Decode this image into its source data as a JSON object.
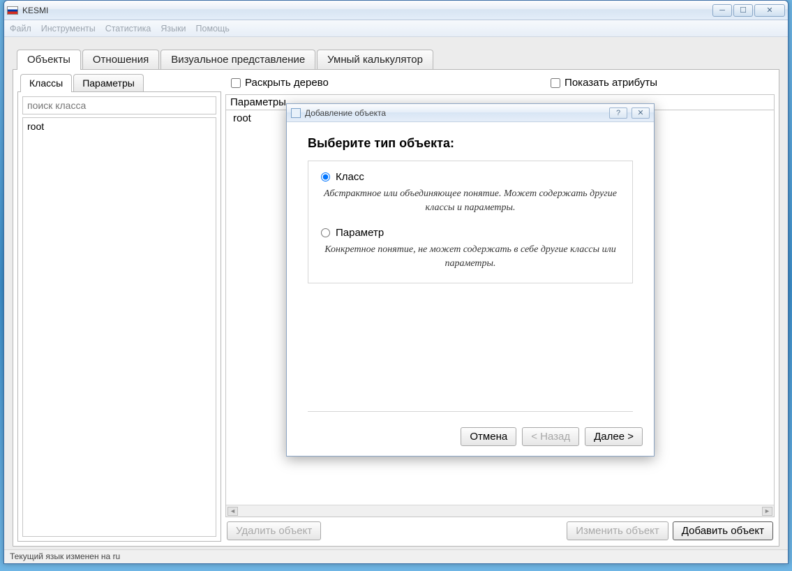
{
  "window": {
    "title": "KESMI"
  },
  "menu": {
    "file": "Файл",
    "tools": "Инструменты",
    "stats": "Статистика",
    "langs": "Языки",
    "help": "Помощь"
  },
  "tabs": {
    "objects": "Объекты",
    "relations": "Отношения",
    "visual": "Визуальное представление",
    "calc": "Умный калькулятор"
  },
  "subtabs": {
    "classes": "Классы",
    "params": "Параметры"
  },
  "left": {
    "search_placeholder": "поиск класса",
    "tree_root": "root"
  },
  "checks": {
    "expand": "Раскрыть дерево",
    "show_attrs": "Показать атрибуты"
  },
  "param_panel": {
    "header": "Параметры",
    "row0": "root"
  },
  "buttons": {
    "delete": "Удалить объект",
    "edit": "Изменить объект",
    "add": "Добавить объект"
  },
  "status": "Текущий язык изменен на ru",
  "dialog": {
    "title": "Добавление объекта",
    "heading": "Выберите тип объекта:",
    "opt_class": "Класс",
    "opt_class_desc": "Абстрактное или объединяющее понятие. Может содержать другие классы и параметры.",
    "opt_param": "Параметр",
    "opt_param_desc": "Конкретное понятие, не может содержать в себе другие классы или параметры.",
    "cancel": "Отмена",
    "back": "< Назад",
    "next": "Далее >"
  }
}
